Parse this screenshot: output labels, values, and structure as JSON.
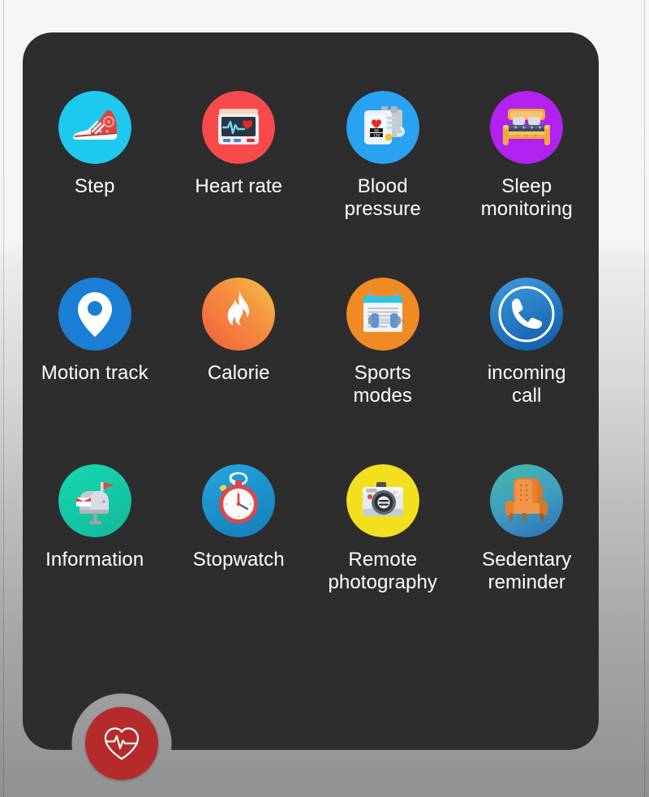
{
  "panel": {
    "background_color": "#2d2d2d",
    "corner_radius_px": 36
  },
  "page": {
    "background_top_color": "#f6f6f6",
    "background_bottom_color": "#919191"
  },
  "grid": {
    "columns": 4,
    "rows": 3,
    "items": [
      {
        "label": "Step",
        "icon": "sneaker-icon",
        "circle_color": "#1ec9f0"
      },
      {
        "label": "Heart rate",
        "icon": "heart-monitor-icon",
        "circle_color": "#f8494d"
      },
      {
        "label": "Blood\npressure",
        "icon": "blood-pressure-monitor-icon",
        "circle_color": "#2aa2f2"
      },
      {
        "label": "Sleep\nmonitoring",
        "icon": "bed-icon",
        "circle_color": "#b122f0"
      },
      {
        "label": "Motion track",
        "icon": "map-pin-icon",
        "circle_color": "#1a7fd4"
      },
      {
        "label": "Calorie",
        "icon": "flame-icon",
        "circle_color": "#f4903e"
      },
      {
        "label": "Sports\nmodes",
        "icon": "clipboard-dumbbell-icon",
        "circle_color": "#f08a22"
      },
      {
        "label": "incoming\ncall",
        "icon": "phone-handset-icon",
        "circle_color": "#2a86d8"
      },
      {
        "label": "Information",
        "icon": "mailbox-icon",
        "circle_color": "#16cfa8"
      },
      {
        "label": "Stopwatch",
        "icon": "stopwatch-icon",
        "circle_color": "#1a9fd4"
      },
      {
        "label": "Remote\nphotography",
        "icon": "camera-icon",
        "circle_color": "#f2e01e"
      },
      {
        "label": "Sedentary\nreminder",
        "icon": "armchair-icon",
        "circle_color": "#3aa9b4"
      }
    ]
  },
  "bottom_button": {
    "name": "heart-rate-button",
    "icon": "heart-pulse-icon",
    "color": "#b52b2b",
    "icon_color": "#ffffff"
  }
}
